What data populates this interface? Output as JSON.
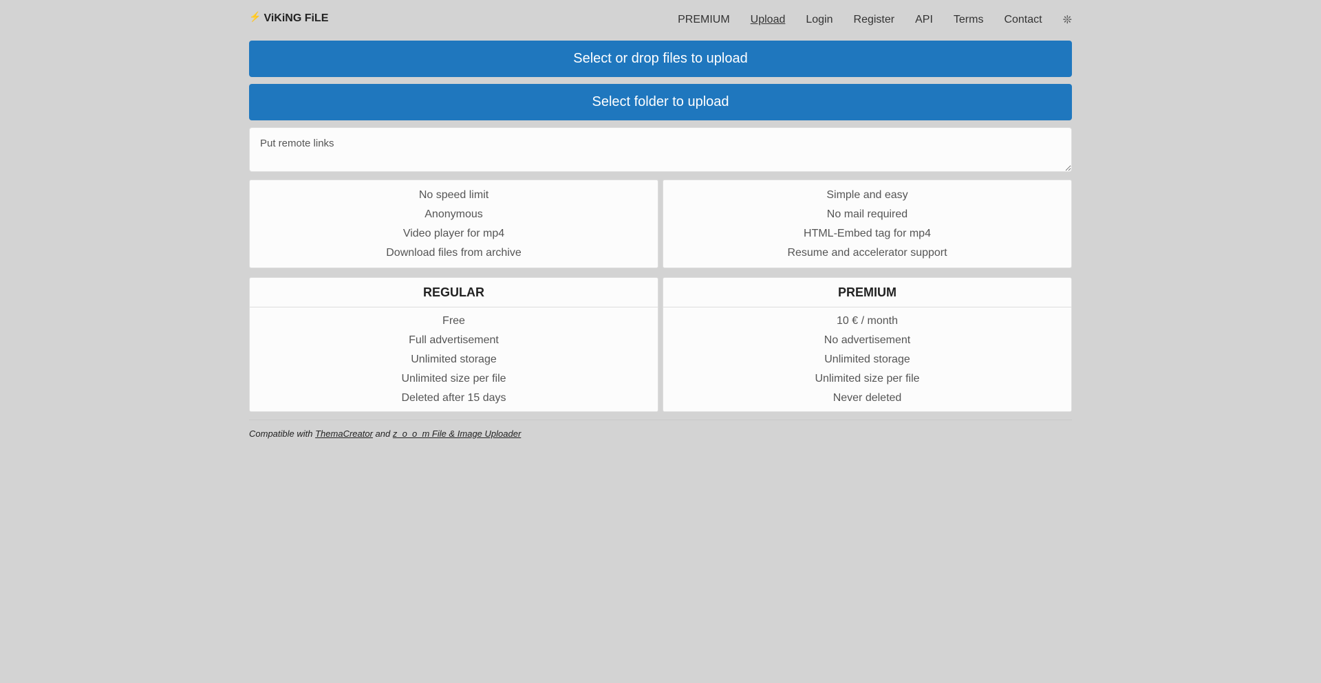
{
  "brand": {
    "icon": "lightning-icon",
    "glyph": "⚡",
    "name": "ViKiNG FiLE"
  },
  "nav": {
    "items": [
      {
        "label": "PREMIUM"
      },
      {
        "label": "Upload",
        "active": true
      },
      {
        "label": "Login"
      },
      {
        "label": "Register"
      },
      {
        "label": "API"
      },
      {
        "label": "Terms"
      },
      {
        "label": "Contact"
      }
    ],
    "theme_icon": "theme-toggle-icon",
    "theme_glyph": "❊"
  },
  "upload": {
    "select_files_label": "Select or drop files to upload",
    "select_folder_label": "Select folder to upload",
    "remote_placeholder": "Put remote links"
  },
  "features": {
    "left": [
      "No speed limit",
      "Anonymous",
      "Video player for mp4",
      "Download files from archive"
    ],
    "right": [
      "Simple and easy",
      "No mail required",
      "HTML-Embed tag for mp4",
      "Resume and accelerator support"
    ]
  },
  "plans": [
    {
      "title": "REGULAR",
      "rows": [
        "Free",
        "Full advertisement",
        "Unlimited storage",
        "Unlimited size per file",
        "Deleted after 15 days"
      ]
    },
    {
      "title": "PREMIUM",
      "rows": [
        "10 € / month",
        "No advertisement",
        "Unlimited storage",
        "Unlimited size per file",
        "Never deleted"
      ]
    }
  ],
  "footer": {
    "prefix": "Compatible with ",
    "link1": "ThemaCreator",
    "middle": " and ",
    "link2": "z_o_o_m File & Image Uploader"
  },
  "colors": {
    "primary": "#1f77be",
    "background": "#d3d3d3",
    "bolt": "#f0a30a"
  }
}
